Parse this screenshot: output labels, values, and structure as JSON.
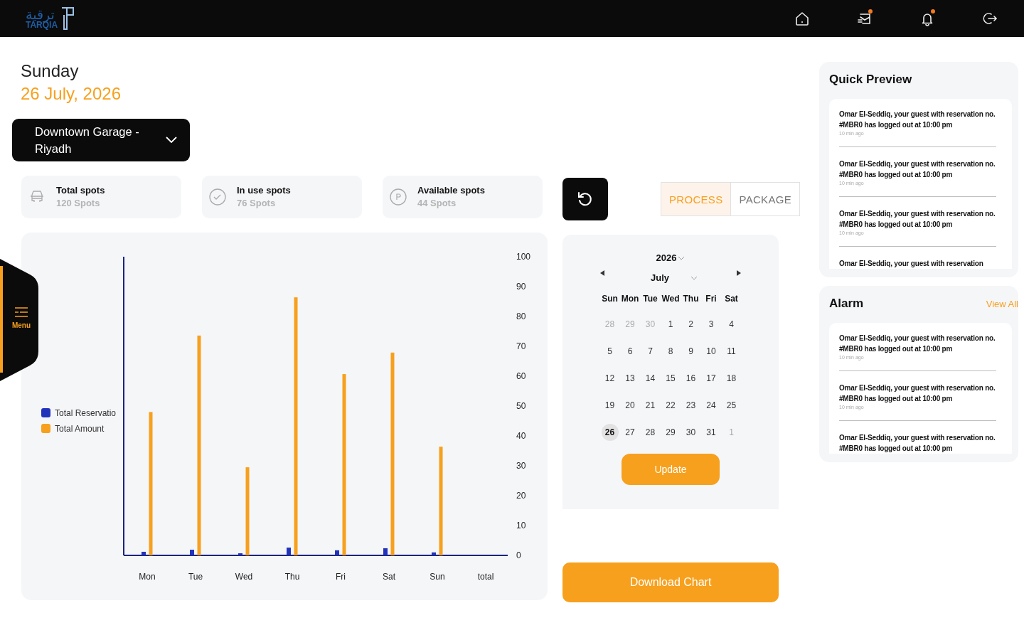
{
  "header": {
    "logo_arabic": "ترقية",
    "logo_latin": "TARQIA",
    "icons": [
      {
        "kind": "home",
        "badge": false
      },
      {
        "kind": "mail",
        "badge": true
      },
      {
        "kind": "bell",
        "badge": true
      },
      {
        "kind": "logout",
        "badge": false
      }
    ]
  },
  "side_menu": {
    "label": "Menu"
  },
  "date": {
    "weekday": "Sunday",
    "full": "26 July, 2026"
  },
  "garage_select": {
    "value": "Downtown Garage - Riyadh"
  },
  "stats": [
    {
      "kind": "car",
      "title": "Total spots",
      "value": "120 Spots"
    },
    {
      "kind": "check",
      "title": "In use spots",
      "value": "76 Spots"
    },
    {
      "kind": "parking",
      "title": "Available spots",
      "value": "44 Spots"
    }
  ],
  "tabs": [
    {
      "label": "PROCESS",
      "selected": true
    },
    {
      "label": "PACKAGE",
      "selected": false
    }
  ],
  "chart": {
    "chart_data": {
      "type": "bar",
      "legend": true,
      "categories": [
        "Mon",
        "Tue",
        "Wed",
        "Thu",
        "Fri",
        "Sat",
        "Sun",
        "total"
      ],
      "ylim": [
        0,
        100
      ],
      "yticks": [
        0,
        10,
        20,
        30,
        40,
        50,
        60,
        70,
        80,
        90,
        100
      ],
      "series": [
        {
          "name": "Total Reservatio",
          "color": "#2233bb",
          "values": [
            1.2,
            1.9,
            0.7,
            2.6,
            1.7,
            2.4,
            1.0,
            null
          ]
        },
        {
          "name": "Total Amount",
          "color": "#f7a01d",
          "values": [
            48,
            73.6,
            29.5,
            86.4,
            60.7,
            67.9,
            36.4,
            null
          ]
        }
      ]
    }
  },
  "calendar": {
    "year": "2026",
    "month": "July",
    "weekdays": [
      "Sun",
      "Mon",
      "Tue",
      "Wed",
      "Thu",
      "Fri",
      "Sat"
    ],
    "weeks": [
      [
        {
          "day": "28",
          "muted": true,
          "selected": false
        },
        {
          "day": "29",
          "muted": true,
          "selected": false
        },
        {
          "day": "30",
          "muted": true,
          "selected": false
        },
        {
          "day": "1",
          "muted": false,
          "selected": false
        },
        {
          "day": "2",
          "muted": false,
          "selected": false
        },
        {
          "day": "3",
          "muted": false,
          "selected": false
        },
        {
          "day": "4",
          "muted": false,
          "selected": false
        }
      ],
      [
        {
          "day": "5",
          "muted": false,
          "selected": false
        },
        {
          "day": "6",
          "muted": false,
          "selected": false
        },
        {
          "day": "7",
          "muted": false,
          "selected": false
        },
        {
          "day": "8",
          "muted": false,
          "selected": false
        },
        {
          "day": "9",
          "muted": false,
          "selected": false
        },
        {
          "day": "10",
          "muted": false,
          "selected": false
        },
        {
          "day": "11",
          "muted": false,
          "selected": false
        }
      ],
      [
        {
          "day": "12",
          "muted": false,
          "selected": false
        },
        {
          "day": "13",
          "muted": false,
          "selected": false
        },
        {
          "day": "14",
          "muted": false,
          "selected": false
        },
        {
          "day": "15",
          "muted": false,
          "selected": false
        },
        {
          "day": "16",
          "muted": false,
          "selected": false
        },
        {
          "day": "17",
          "muted": false,
          "selected": false
        },
        {
          "day": "18",
          "muted": false,
          "selected": false
        }
      ],
      [
        {
          "day": "19",
          "muted": false,
          "selected": false
        },
        {
          "day": "20",
          "muted": false,
          "selected": false
        },
        {
          "day": "21",
          "muted": false,
          "selected": false
        },
        {
          "day": "22",
          "muted": false,
          "selected": false
        },
        {
          "day": "23",
          "muted": false,
          "selected": false
        },
        {
          "day": "24",
          "muted": false,
          "selected": false
        },
        {
          "day": "25",
          "muted": false,
          "selected": false
        }
      ],
      [
        {
          "day": "26",
          "muted": false,
          "selected": true
        },
        {
          "day": "27",
          "muted": false,
          "selected": false
        },
        {
          "day": "28",
          "muted": false,
          "selected": false
        },
        {
          "day": "29",
          "muted": false,
          "selected": false
        },
        {
          "day": "30",
          "muted": false,
          "selected": false
        },
        {
          "day": "31",
          "muted": false,
          "selected": false
        },
        {
          "day": "1",
          "muted": true,
          "selected": false
        }
      ]
    ],
    "button": "Update"
  },
  "download_button": "Download Chart",
  "quick_preview": {
    "title": "Quick Preview",
    "items": [
      {
        "text": "Omar El-Seddiq, your guest with reservation no. #MBR0 has logged out at 10:00 pm",
        "time": "10 min ago"
      },
      {
        "text": "Omar El-Seddiq, your guest with reservation no. #MBR0 has logged out at 10:00 pm",
        "time": "10 min ago"
      },
      {
        "text": "Omar El-Seddiq, your guest with reservation no. #MBR0 has logged out at 10:00 pm",
        "time": "10 min ago"
      },
      {
        "text": "Omar El-Seddiq, your guest with reservation"
      }
    ]
  },
  "alarm": {
    "title": "Alarm",
    "link": "View All",
    "items": [
      {
        "text": "Omar El-Seddiq, your guest with reservation no. #MBR0 has logged out at 10:00 pm",
        "time": "10 min ago"
      },
      {
        "text": "Omar El-Seddiq, your guest with reservation no. #MBR0 has logged out at 10:00 pm",
        "time": "10 min ago"
      },
      {
        "text": "Omar El-Seddiq, your guest with reservation no. #MBR0 has logged out at 10:00 pm"
      }
    ]
  }
}
